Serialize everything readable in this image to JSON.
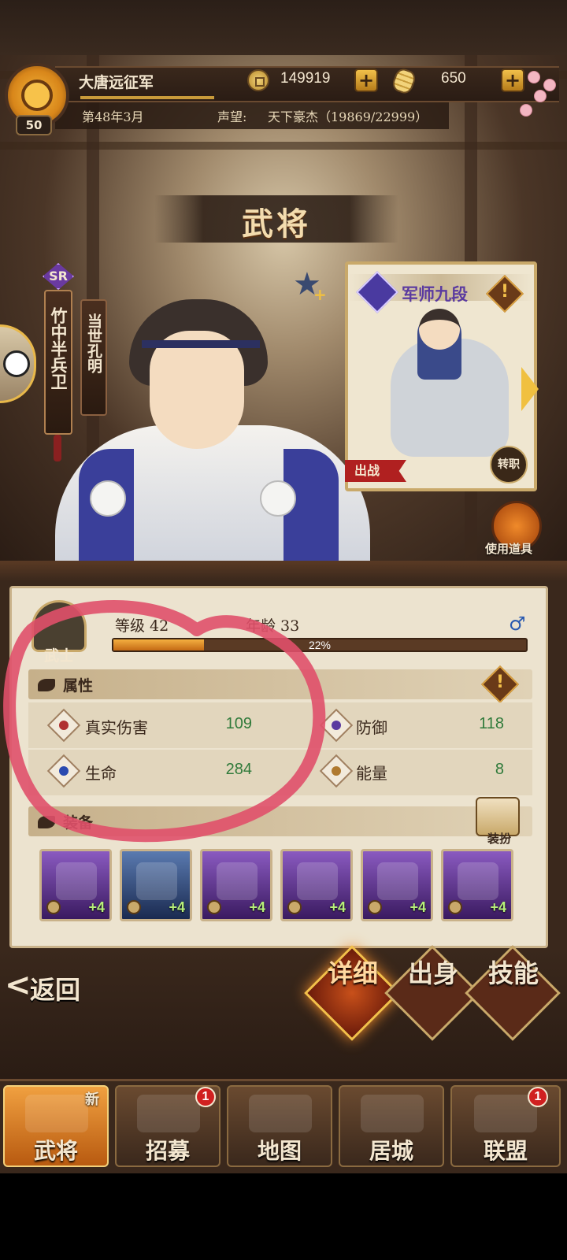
{
  "header": {
    "army_name": "大唐远征军",
    "player_level": "50",
    "date": "第48年3月",
    "fame_label": "声望:",
    "fame_value": "天下豪杰（19869/22999）",
    "coins": "149919",
    "koban": "650"
  },
  "title": "武将",
  "character": {
    "rarity": "SR",
    "name": "竹中半兵卫",
    "epithet": "当世孔明"
  },
  "class_card": {
    "class_name": "军师九段",
    "sortie_label": "出战",
    "change_job_label": "转职"
  },
  "use_item_label": "使用道具",
  "stats": {
    "rank_label": "武士",
    "level_text": "等级 42",
    "age_text": "年龄 33",
    "xp_percent": 22,
    "xp_text": "22%"
  },
  "attributes": {
    "section_label": "属性",
    "items": [
      {
        "name": "真实伤害",
        "value": "109",
        "icon_color": "#b03030"
      },
      {
        "name": "防御",
        "value": "118",
        "icon_color": "#5a3aa0"
      },
      {
        "name": "生命",
        "value": "284",
        "icon_color": "#2a4ab0"
      },
      {
        "name": "能量",
        "value": "8",
        "icon_color": "#b07a30"
      }
    ]
  },
  "equipment": {
    "section_label": "装备",
    "dress_label": "装扮",
    "slots": [
      {
        "name": "fan",
        "level": "+4",
        "rarity": "purple"
      },
      {
        "name": "tassel",
        "level": "+4",
        "rarity": "blue"
      },
      {
        "name": "hat",
        "level": "+4",
        "rarity": "purple"
      },
      {
        "name": "robe",
        "level": "+4",
        "rarity": "purple"
      },
      {
        "name": "sash",
        "level": "+4",
        "rarity": "purple"
      },
      {
        "name": "sandals",
        "level": "+4",
        "rarity": "purple"
      }
    ]
  },
  "actions": {
    "back_label": "返回",
    "tabs": [
      "详细",
      "出身",
      "技能"
    ],
    "active_tab": 0
  },
  "nav": {
    "items": [
      {
        "label": "武将",
        "badge": "",
        "new": "新"
      },
      {
        "label": "招募",
        "badge": "1",
        "new": ""
      },
      {
        "label": "地图",
        "badge": "",
        "new": ""
      },
      {
        "label": "居城",
        "badge": "",
        "new": ""
      },
      {
        "label": "联盟",
        "badge": "1",
        "new": ""
      }
    ],
    "active": 0
  },
  "colors": {
    "accent_gold": "#f0c040",
    "stat_green": "#2f7a3a",
    "annotation_red": "#e0506a"
  }
}
